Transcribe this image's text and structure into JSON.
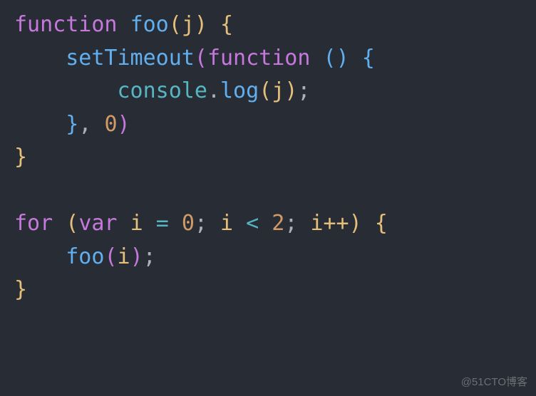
{
  "code": {
    "line1": {
      "kw": "function",
      "fn": "foo",
      "param": "j"
    },
    "line2": {
      "fn": "setTimeout",
      "kw": "function"
    },
    "line3": {
      "obj": "console",
      "fn": "log",
      "param": "j"
    },
    "line4": {
      "num": "0"
    },
    "line7": {
      "kw1": "for",
      "kw2": "var",
      "param": "i",
      "num1": "0",
      "num2": "2",
      "inc": "i++"
    },
    "line8": {
      "fn": "foo",
      "param": "i"
    }
  },
  "punct": {
    "lparen": "(",
    "rparen": ")",
    "lbrace": "{",
    "rbrace": "}",
    "comma": ",",
    "semi": ";",
    "dot": ".",
    "eq": "=",
    "lt": "<",
    "space": " "
  },
  "watermark": "@51CTO博客"
}
